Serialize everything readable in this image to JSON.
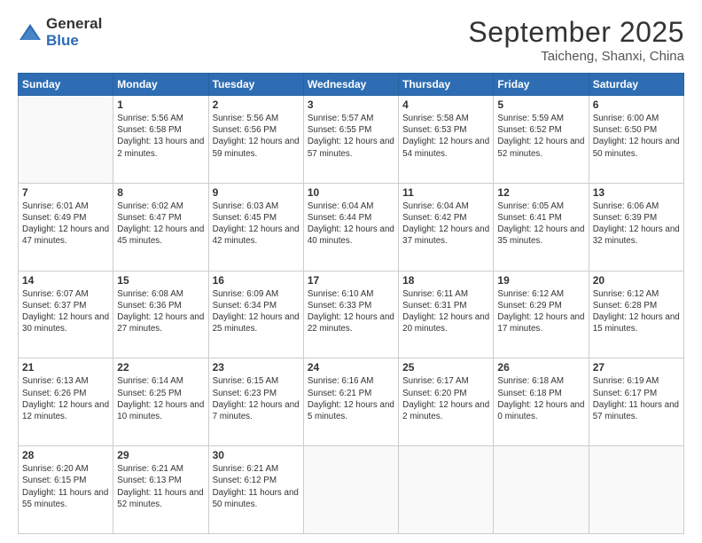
{
  "logo": {
    "general": "General",
    "blue": "Blue"
  },
  "header": {
    "month": "September 2025",
    "location": "Taicheng, Shanxi, China"
  },
  "weekdays": [
    "Sunday",
    "Monday",
    "Tuesday",
    "Wednesday",
    "Thursday",
    "Friday",
    "Saturday"
  ],
  "weeks": [
    [
      {
        "day": "",
        "sunrise": "",
        "sunset": "",
        "daylight": ""
      },
      {
        "day": "1",
        "sunrise": "Sunrise: 5:56 AM",
        "sunset": "Sunset: 6:58 PM",
        "daylight": "Daylight: 13 hours and 2 minutes."
      },
      {
        "day": "2",
        "sunrise": "Sunrise: 5:56 AM",
        "sunset": "Sunset: 6:56 PM",
        "daylight": "Daylight: 12 hours and 59 minutes."
      },
      {
        "day": "3",
        "sunrise": "Sunrise: 5:57 AM",
        "sunset": "Sunset: 6:55 PM",
        "daylight": "Daylight: 12 hours and 57 minutes."
      },
      {
        "day": "4",
        "sunrise": "Sunrise: 5:58 AM",
        "sunset": "Sunset: 6:53 PM",
        "daylight": "Daylight: 12 hours and 54 minutes."
      },
      {
        "day": "5",
        "sunrise": "Sunrise: 5:59 AM",
        "sunset": "Sunset: 6:52 PM",
        "daylight": "Daylight: 12 hours and 52 minutes."
      },
      {
        "day": "6",
        "sunrise": "Sunrise: 6:00 AM",
        "sunset": "Sunset: 6:50 PM",
        "daylight": "Daylight: 12 hours and 50 minutes."
      }
    ],
    [
      {
        "day": "7",
        "sunrise": "Sunrise: 6:01 AM",
        "sunset": "Sunset: 6:49 PM",
        "daylight": "Daylight: 12 hours and 47 minutes."
      },
      {
        "day": "8",
        "sunrise": "Sunrise: 6:02 AM",
        "sunset": "Sunset: 6:47 PM",
        "daylight": "Daylight: 12 hours and 45 minutes."
      },
      {
        "day": "9",
        "sunrise": "Sunrise: 6:03 AM",
        "sunset": "Sunset: 6:45 PM",
        "daylight": "Daylight: 12 hours and 42 minutes."
      },
      {
        "day": "10",
        "sunrise": "Sunrise: 6:04 AM",
        "sunset": "Sunset: 6:44 PM",
        "daylight": "Daylight: 12 hours and 40 minutes."
      },
      {
        "day": "11",
        "sunrise": "Sunrise: 6:04 AM",
        "sunset": "Sunset: 6:42 PM",
        "daylight": "Daylight: 12 hours and 37 minutes."
      },
      {
        "day": "12",
        "sunrise": "Sunrise: 6:05 AM",
        "sunset": "Sunset: 6:41 PM",
        "daylight": "Daylight: 12 hours and 35 minutes."
      },
      {
        "day": "13",
        "sunrise": "Sunrise: 6:06 AM",
        "sunset": "Sunset: 6:39 PM",
        "daylight": "Daylight: 12 hours and 32 minutes."
      }
    ],
    [
      {
        "day": "14",
        "sunrise": "Sunrise: 6:07 AM",
        "sunset": "Sunset: 6:37 PM",
        "daylight": "Daylight: 12 hours and 30 minutes."
      },
      {
        "day": "15",
        "sunrise": "Sunrise: 6:08 AM",
        "sunset": "Sunset: 6:36 PM",
        "daylight": "Daylight: 12 hours and 27 minutes."
      },
      {
        "day": "16",
        "sunrise": "Sunrise: 6:09 AM",
        "sunset": "Sunset: 6:34 PM",
        "daylight": "Daylight: 12 hours and 25 minutes."
      },
      {
        "day": "17",
        "sunrise": "Sunrise: 6:10 AM",
        "sunset": "Sunset: 6:33 PM",
        "daylight": "Daylight: 12 hours and 22 minutes."
      },
      {
        "day": "18",
        "sunrise": "Sunrise: 6:11 AM",
        "sunset": "Sunset: 6:31 PM",
        "daylight": "Daylight: 12 hours and 20 minutes."
      },
      {
        "day": "19",
        "sunrise": "Sunrise: 6:12 AM",
        "sunset": "Sunset: 6:29 PM",
        "daylight": "Daylight: 12 hours and 17 minutes."
      },
      {
        "day": "20",
        "sunrise": "Sunrise: 6:12 AM",
        "sunset": "Sunset: 6:28 PM",
        "daylight": "Daylight: 12 hours and 15 minutes."
      }
    ],
    [
      {
        "day": "21",
        "sunrise": "Sunrise: 6:13 AM",
        "sunset": "Sunset: 6:26 PM",
        "daylight": "Daylight: 12 hours and 12 minutes."
      },
      {
        "day": "22",
        "sunrise": "Sunrise: 6:14 AM",
        "sunset": "Sunset: 6:25 PM",
        "daylight": "Daylight: 12 hours and 10 minutes."
      },
      {
        "day": "23",
        "sunrise": "Sunrise: 6:15 AM",
        "sunset": "Sunset: 6:23 PM",
        "daylight": "Daylight: 12 hours and 7 minutes."
      },
      {
        "day": "24",
        "sunrise": "Sunrise: 6:16 AM",
        "sunset": "Sunset: 6:21 PM",
        "daylight": "Daylight: 12 hours and 5 minutes."
      },
      {
        "day": "25",
        "sunrise": "Sunrise: 6:17 AM",
        "sunset": "Sunset: 6:20 PM",
        "daylight": "Daylight: 12 hours and 2 minutes."
      },
      {
        "day": "26",
        "sunrise": "Sunrise: 6:18 AM",
        "sunset": "Sunset: 6:18 PM",
        "daylight": "Daylight: 12 hours and 0 minutes."
      },
      {
        "day": "27",
        "sunrise": "Sunrise: 6:19 AM",
        "sunset": "Sunset: 6:17 PM",
        "daylight": "Daylight: 11 hours and 57 minutes."
      }
    ],
    [
      {
        "day": "28",
        "sunrise": "Sunrise: 6:20 AM",
        "sunset": "Sunset: 6:15 PM",
        "daylight": "Daylight: 11 hours and 55 minutes."
      },
      {
        "day": "29",
        "sunrise": "Sunrise: 6:21 AM",
        "sunset": "Sunset: 6:13 PM",
        "daylight": "Daylight: 11 hours and 52 minutes."
      },
      {
        "day": "30",
        "sunrise": "Sunrise: 6:21 AM",
        "sunset": "Sunset: 6:12 PM",
        "daylight": "Daylight: 11 hours and 50 minutes."
      },
      {
        "day": "",
        "sunrise": "",
        "sunset": "",
        "daylight": ""
      },
      {
        "day": "",
        "sunrise": "",
        "sunset": "",
        "daylight": ""
      },
      {
        "day": "",
        "sunrise": "",
        "sunset": "",
        "daylight": ""
      },
      {
        "day": "",
        "sunrise": "",
        "sunset": "",
        "daylight": ""
      }
    ]
  ]
}
